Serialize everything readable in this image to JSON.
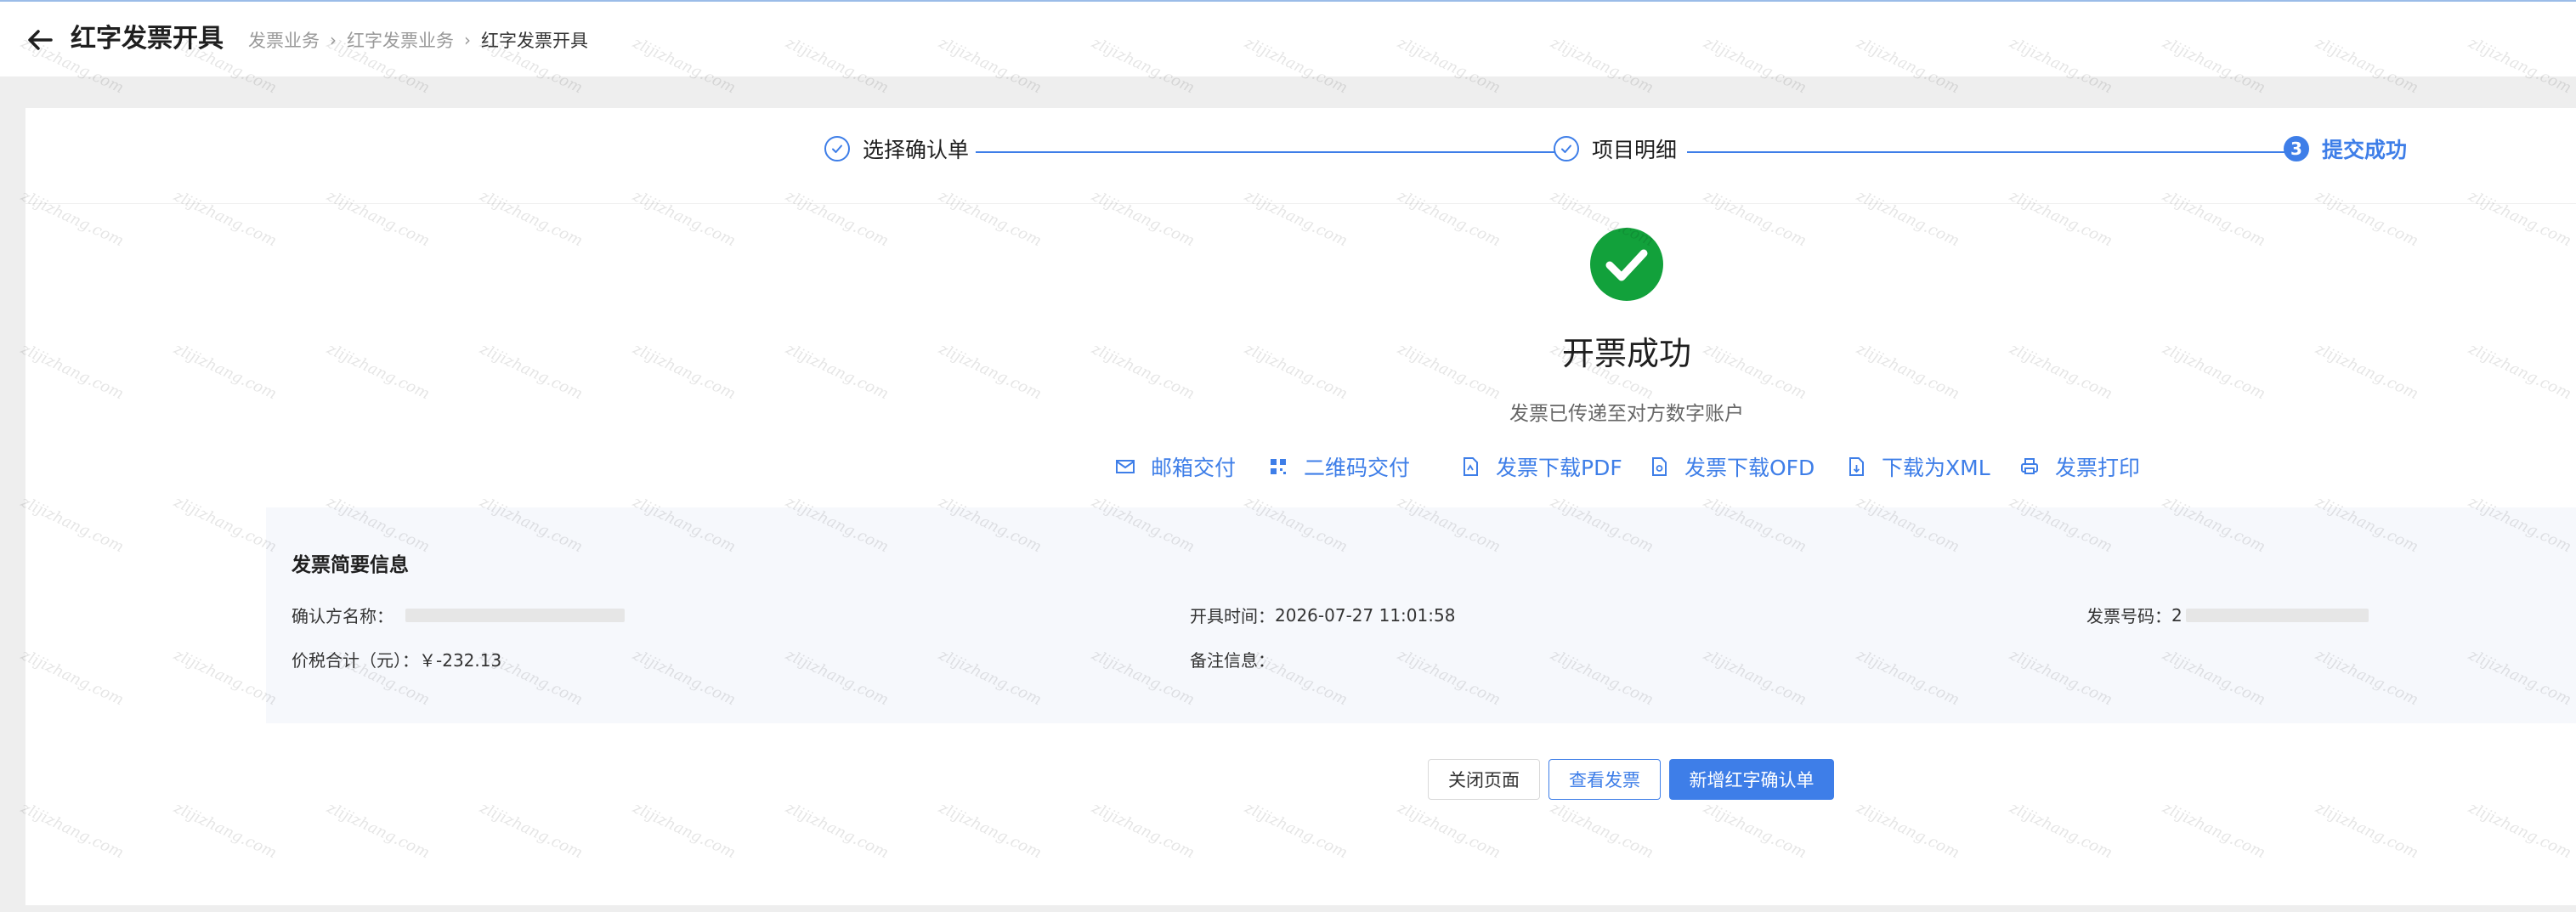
{
  "header": {
    "title": "红字发票开具",
    "breadcrumb": [
      "发票业务",
      "红字发票业务",
      "红字发票开具"
    ]
  },
  "steps": [
    {
      "label": "选择确认单",
      "status": "done"
    },
    {
      "label": "项目明细",
      "status": "done"
    },
    {
      "number": "3",
      "label": "提交成功",
      "status": "active"
    }
  ],
  "result": {
    "title": "开票成功",
    "subtitle": "发票已传递至对方数字账户"
  },
  "actions": [
    {
      "icon": "mail-icon",
      "label": "邮箱交付"
    },
    {
      "icon": "qrcode-icon",
      "label": "二维码交付"
    },
    {
      "icon": "pdf-file-icon",
      "label": "发票下载PDF"
    },
    {
      "icon": "ofd-file-icon",
      "label": "发票下载OFD"
    },
    {
      "icon": "xml-file-icon",
      "label": "下载为XML"
    },
    {
      "icon": "printer-icon",
      "label": "发票打印"
    }
  ],
  "summary": {
    "title": "发票简要信息",
    "confirm_party_label": "确认方名称：",
    "issue_time_label": "开具时间：",
    "issue_time_value": "2026-07-27 11:01:58",
    "invoice_no_label": "发票号码：",
    "invoice_no_value": "2",
    "total_label": "价税合计（元）：",
    "total_value": "￥-232.13",
    "remark_label": "备注信息：",
    "remark_value": ""
  },
  "buttons": {
    "close": "关闭页面",
    "view": "查看发票",
    "add": "新增红字确认单"
  },
  "watermark": "zlijizhang.com",
  "colors": {
    "accent": "#3e7ee8",
    "success": "#12a13b",
    "background": "#eeeeee"
  }
}
